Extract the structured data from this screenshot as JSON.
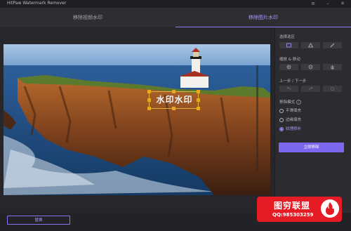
{
  "app": {
    "title": "HitPaw Watermark Remover"
  },
  "window_controls": {
    "menu_icon": "menu-icon",
    "minimize_icon": "minimize-icon",
    "close_icon": "close-icon"
  },
  "tabs": [
    {
      "label": "移除视频水印",
      "active": false
    },
    {
      "label": "移除图片水印",
      "active": true
    }
  ],
  "canvas": {
    "watermark_text": "水印水印",
    "image_description_icon": "lighthouse-photo"
  },
  "panel": {
    "select_area_label": "选择选区",
    "select_tools": [
      "rectangle-select-icon",
      "polygon-select-icon",
      "brush-select-icon"
    ],
    "zoom_label": "缩放 & 移动",
    "zoom_tools": [
      "zoom-in-icon",
      "zoom-out-icon",
      "hand-move-icon"
    ],
    "history_label": "上一步 / 下一步",
    "history_tools": [
      "undo-icon",
      "redo-icon",
      "reset-icon"
    ],
    "mode_label": "移除模式",
    "modes": [
      {
        "label": "平滑填充",
        "selected": false
      },
      {
        "label": "边缘填充",
        "selected": false
      },
      {
        "label": "纹理修补",
        "selected": true
      }
    ],
    "remove_button": "立即移除"
  },
  "bottom": {
    "replace_button": "替换"
  },
  "brand_banner": {
    "name": "图穷联盟",
    "qq": "QQ:985303259"
  },
  "colors": {
    "accent": "#7b68ee",
    "handle": "#e8a91f",
    "banner": "#e51b25"
  }
}
